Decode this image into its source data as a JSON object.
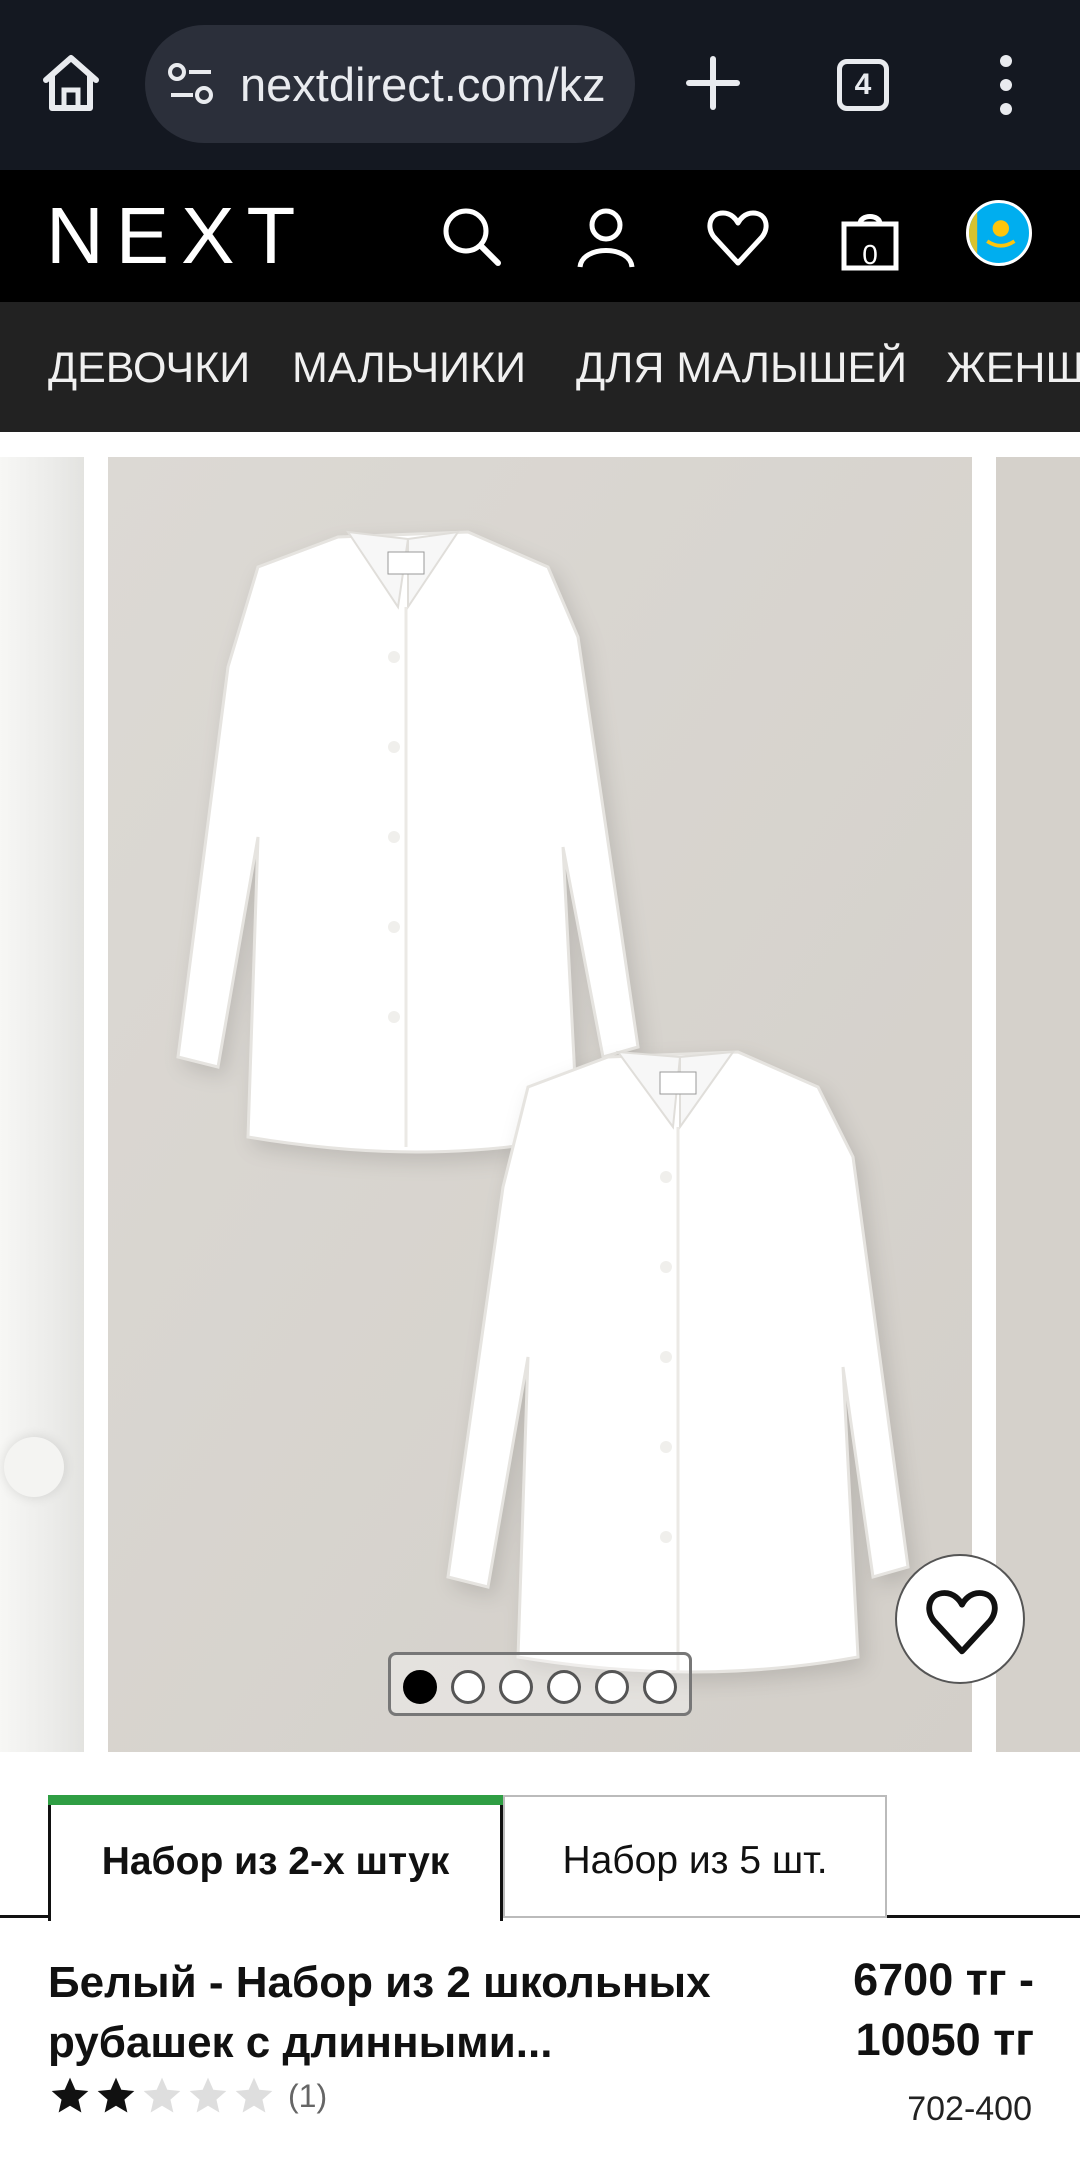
{
  "browser": {
    "url": "nextdirect.com/kz",
    "tabs_count": "4",
    "icons": [
      "home-icon",
      "site-settings-icon",
      "new-tab-icon",
      "tab-switcher-icon",
      "menu-kebab-icon"
    ]
  },
  "header": {
    "logo": "NEXT",
    "bag_count": "0",
    "icons": [
      "search-icon",
      "account-icon",
      "favourites-icon",
      "bag-icon",
      "kazakhstan-flag-icon"
    ]
  },
  "nav": {
    "items": [
      {
        "label": "ДЕВОЧКИ"
      },
      {
        "label": "МАЛЬЧИКИ"
      },
      {
        "label": "ДЛЯ МАЛЫШЕЙ"
      },
      {
        "label": "ЖЕНЩ"
      }
    ]
  },
  "gallery": {
    "total_images": 6,
    "active_index": 0
  },
  "options": {
    "tabs": [
      {
        "label": "Набор из 2-х штук",
        "active": true
      },
      {
        "label": "Набор из 5 шт.",
        "active": false
      }
    ]
  },
  "product": {
    "title_line1": "Белый - Набор из 2 школьных",
    "title_line2": "рубашек с длинными...",
    "price_line1": "6700 тг -",
    "price_line2": "10050 тг",
    "rating_stars": 2,
    "rating_max": 5,
    "review_count": "(1)",
    "sku": "702-400"
  },
  "colors": {
    "browser_bg": "#141821",
    "header_bg": "#000000",
    "nav_bg": "#222222",
    "active_tab_accent": "#2f9e44",
    "photo_bg": "#d9d5d0"
  }
}
